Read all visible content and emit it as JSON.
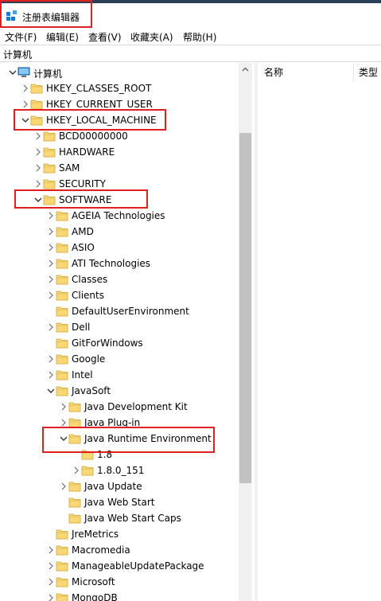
{
  "window": {
    "title": "注册表编辑器"
  },
  "menu": [
    {
      "label": "文件(F)"
    },
    {
      "label": "编辑(E)"
    },
    {
      "label": "查看(V)"
    },
    {
      "label": "收藏夹(A)"
    },
    {
      "label": "帮助(H)"
    }
  ],
  "address": {
    "path": "计算机"
  },
  "tree": [
    {
      "label": "计算机",
      "level": 0,
      "expanded": true,
      "icon": "computer-icon"
    },
    {
      "label": "HKEY_CLASSES_ROOT",
      "level": 1,
      "expanded": false,
      "icon": "folder-icon"
    },
    {
      "label": "HKEY_CURRENT_USER",
      "level": 1,
      "expanded": false,
      "icon": "folder-icon"
    },
    {
      "label": "HKEY_LOCAL_MACHINE",
      "level": 1,
      "expanded": true,
      "icon": "folder-icon"
    },
    {
      "label": "BCD00000000",
      "level": 2,
      "expanded": false,
      "icon": "folder-icon"
    },
    {
      "label": "HARDWARE",
      "level": 2,
      "expanded": false,
      "icon": "folder-icon"
    },
    {
      "label": "SAM",
      "level": 2,
      "expanded": false,
      "icon": "folder-icon"
    },
    {
      "label": "SECURITY",
      "level": 2,
      "expanded": false,
      "icon": "folder-icon"
    },
    {
      "label": "SOFTWARE",
      "level": 2,
      "expanded": true,
      "icon": "folder-icon"
    },
    {
      "label": "AGEIA Technologies",
      "level": 3,
      "expanded": false,
      "icon": "folder-icon"
    },
    {
      "label": "AMD",
      "level": 3,
      "expanded": false,
      "icon": "folder-icon"
    },
    {
      "label": "ASIO",
      "level": 3,
      "expanded": false,
      "icon": "folder-icon"
    },
    {
      "label": "ATI Technologies",
      "level": 3,
      "expanded": false,
      "icon": "folder-icon"
    },
    {
      "label": "Classes",
      "level": 3,
      "expanded": false,
      "icon": "folder-icon"
    },
    {
      "label": "Clients",
      "level": 3,
      "expanded": false,
      "icon": "folder-icon"
    },
    {
      "label": "DefaultUserEnvironment",
      "level": 3,
      "expanded": null,
      "icon": "folder-icon"
    },
    {
      "label": "Dell",
      "level": 3,
      "expanded": false,
      "icon": "folder-icon"
    },
    {
      "label": "GitForWindows",
      "level": 3,
      "expanded": null,
      "icon": "folder-icon"
    },
    {
      "label": "Google",
      "level": 3,
      "expanded": false,
      "icon": "folder-icon"
    },
    {
      "label": "Intel",
      "level": 3,
      "expanded": false,
      "icon": "folder-icon"
    },
    {
      "label": "JavaSoft",
      "level": 3,
      "expanded": true,
      "icon": "folder-icon"
    },
    {
      "label": "Java Development Kit",
      "level": 4,
      "expanded": false,
      "icon": "folder-icon"
    },
    {
      "label": "Java Plug-in",
      "level": 4,
      "expanded": false,
      "icon": "folder-icon"
    },
    {
      "label": "Java Runtime Environment",
      "level": 4,
      "expanded": true,
      "icon": "folder-icon"
    },
    {
      "label": "1.8",
      "level": 5,
      "expanded": null,
      "icon": "folder-icon"
    },
    {
      "label": "1.8.0_151",
      "level": 5,
      "expanded": false,
      "icon": "folder-icon"
    },
    {
      "label": "Java Update",
      "level": 4,
      "expanded": false,
      "icon": "folder-icon"
    },
    {
      "label": "Java Web Start",
      "level": 4,
      "expanded": null,
      "icon": "folder-icon"
    },
    {
      "label": "Java Web Start Caps",
      "level": 4,
      "expanded": null,
      "icon": "folder-icon"
    },
    {
      "label": "JreMetrics",
      "level": 3,
      "expanded": null,
      "icon": "folder-icon"
    },
    {
      "label": "Macromedia",
      "level": 3,
      "expanded": false,
      "icon": "folder-icon"
    },
    {
      "label": "ManageableUpdatePackage",
      "level": 3,
      "expanded": false,
      "icon": "folder-icon"
    },
    {
      "label": "Microsoft",
      "level": 3,
      "expanded": false,
      "icon": "folder-icon"
    },
    {
      "label": "MongoDB",
      "level": 3,
      "expanded": false,
      "icon": "folder-icon"
    }
  ],
  "list": {
    "columns": [
      {
        "label": "名称"
      },
      {
        "label": "类型"
      }
    ]
  },
  "colors": {
    "folder": "#f8d775",
    "folder_edge": "#dcb04c",
    "annotation": "#e0201f",
    "chevron": "#6d6d6d"
  }
}
